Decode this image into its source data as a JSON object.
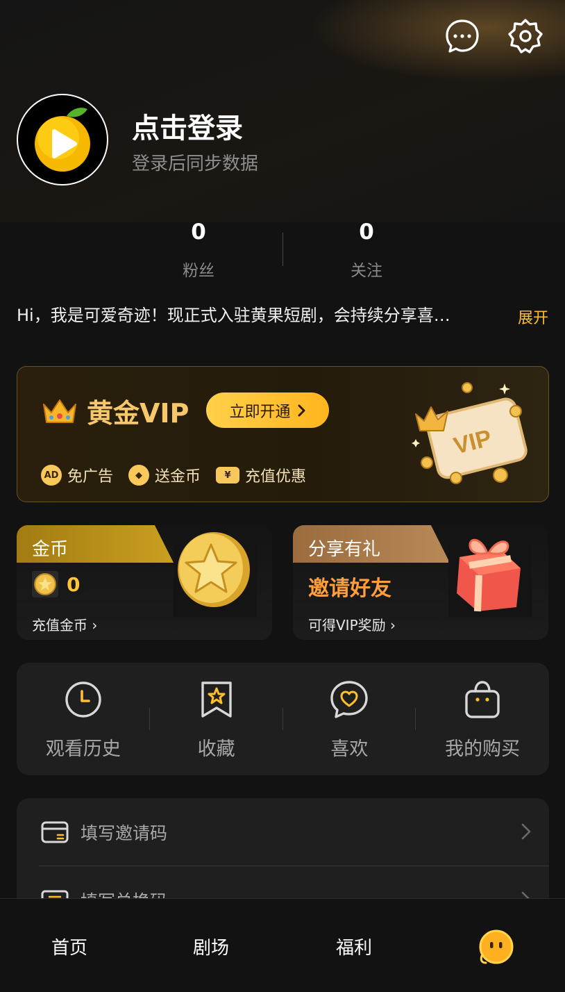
{
  "header": {
    "message_icon": "chat-bubble-icon",
    "settings_icon": "gear-icon"
  },
  "profile": {
    "avatar_icon": "orange-play-logo",
    "login_title": "点击登录",
    "login_subtitle": "登录后同步数据"
  },
  "stats": [
    {
      "value": "0",
      "label": "粉丝"
    },
    {
      "value": "0",
      "label": "关注"
    }
  ],
  "bio": {
    "text": "Hi，我是可爱奇迹！现正式入驻黄果短剧，会持续分享喜…",
    "expand_label": "展开"
  },
  "vip": {
    "title": "黄金VIP",
    "open_button": "立即开通",
    "badge_text": "VIP",
    "features": [
      {
        "icon": "AD",
        "label": "免广告"
      },
      {
        "icon": "◆",
        "label": "送金币"
      },
      {
        "icon": "¥",
        "label": "充值优惠"
      }
    ],
    "accent_color": "#ffc02b"
  },
  "coin_card": {
    "tab": "金币",
    "count": "0",
    "link": "充值金币 ›"
  },
  "share_card": {
    "tab": "分享有礼",
    "headline": "邀请好友",
    "link": "可得VIP奖励 ›"
  },
  "shortcuts": [
    {
      "icon": "clock-icon",
      "label": "观看历史"
    },
    {
      "icon": "bookmark-star-icon",
      "label": "收藏"
    },
    {
      "icon": "heart-chat-icon",
      "label": "喜欢"
    },
    {
      "icon": "shopping-bag-icon",
      "label": "我的购买"
    }
  ],
  "menu": [
    {
      "icon": "invite-card-icon",
      "label": "填写邀请码"
    },
    {
      "icon": "redeem-ticket-icon",
      "label": "填写兑换码"
    }
  ],
  "tabbar": {
    "home": "首页",
    "theater": "剧场",
    "welfare": "福利",
    "me_icon": "smiley-face-icon"
  }
}
